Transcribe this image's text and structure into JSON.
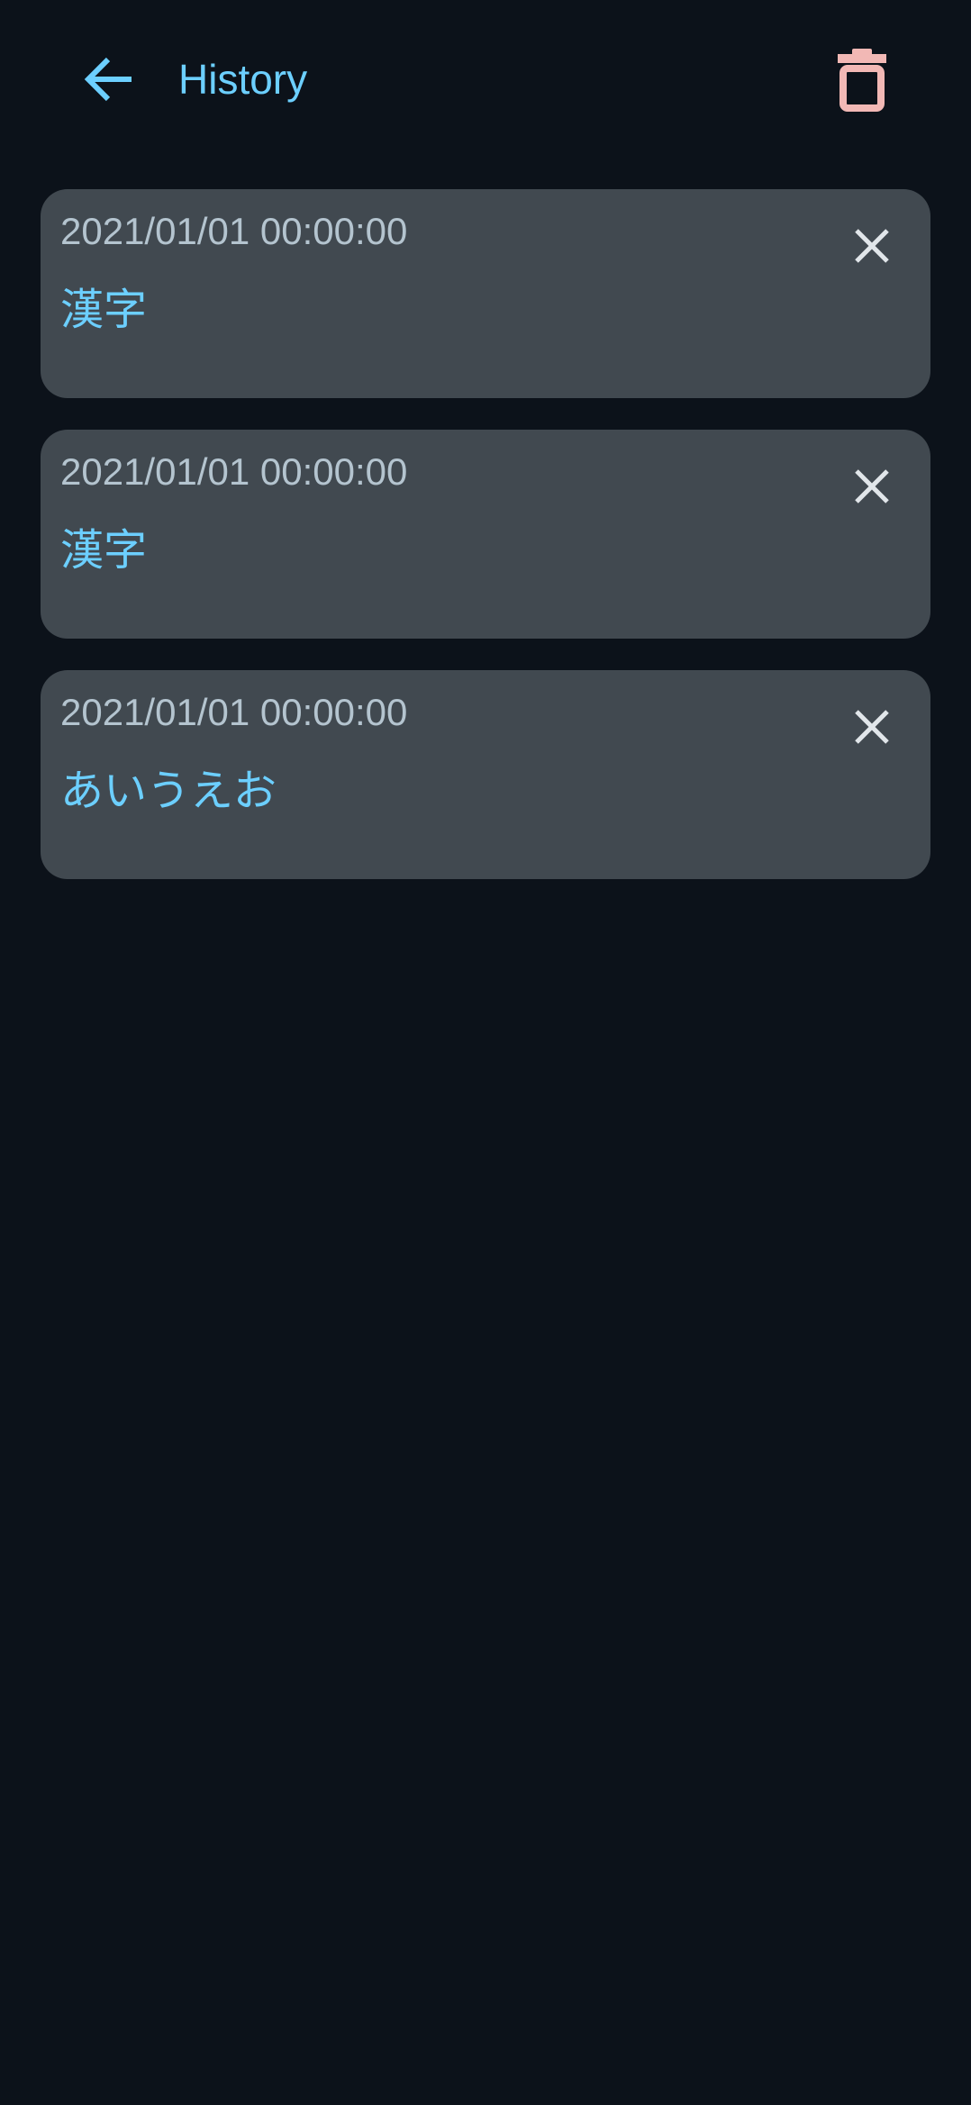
{
  "header": {
    "title": "History",
    "back_icon": "arrow-left-icon",
    "delete_all_icon": "trash-icon"
  },
  "colors": {
    "background": "#0c121a",
    "card": "#414950",
    "accent": "#6ccfff",
    "timestamp": "#b4c4cf",
    "danger": "#f2b8b5",
    "close": "#e1e6ea"
  },
  "items": [
    {
      "timestamp": "2021/01/01 00:00:00",
      "text": "漢字"
    },
    {
      "timestamp": "2021/01/01 00:00:00",
      "text": "漢字"
    },
    {
      "timestamp": "2021/01/01 00:00:00",
      "text": "あいうえお"
    }
  ]
}
